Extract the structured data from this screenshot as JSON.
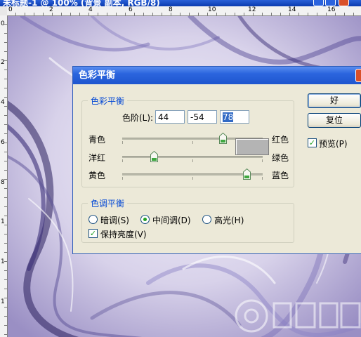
{
  "app_title": "未标题-1 @ 100% (背景 副本, RGB/8)",
  "ruler": {
    "top_numbers": [
      "0",
      "2",
      "4",
      "6",
      "8",
      "10",
      "12",
      "14",
      "16"
    ],
    "left_numbers": [
      "0",
      "2",
      "4",
      "6",
      "8",
      "1",
      "1",
      "1"
    ]
  },
  "dialog": {
    "title": "色彩平衡",
    "color_balance_group": {
      "legend": "色彩平衡",
      "levels_label": "色阶(L):",
      "levels": [
        "44",
        "-54",
        "78"
      ],
      "sliders": [
        {
          "left": "青色",
          "right": "红色",
          "value": 44
        },
        {
          "left": "洋红",
          "right": "绿色",
          "value": -54
        },
        {
          "left": "黄色",
          "right": "蓝色",
          "value": 78
        }
      ],
      "slider_range": [
        -100,
        100
      ]
    },
    "tone_balance_group": {
      "legend": "色调平衡",
      "options": [
        "暗调(S)",
        "中间调(D)",
        "高光(H)"
      ],
      "selected": "中间调(D)",
      "preserve_luminosity": "保持亮度(V)",
      "preserve_checked": true
    },
    "buttons": {
      "ok": "好",
      "reset": "复位"
    },
    "preview": {
      "label": "预览(P)",
      "checked": true
    }
  },
  "colors": {
    "titlebar": "#0a3bb0",
    "dialog_bg": "#ece9d8",
    "legend_text": "#0046d5",
    "canvas_base": "#c9c1e0",
    "swirl_dark": "#2a1f5c"
  }
}
